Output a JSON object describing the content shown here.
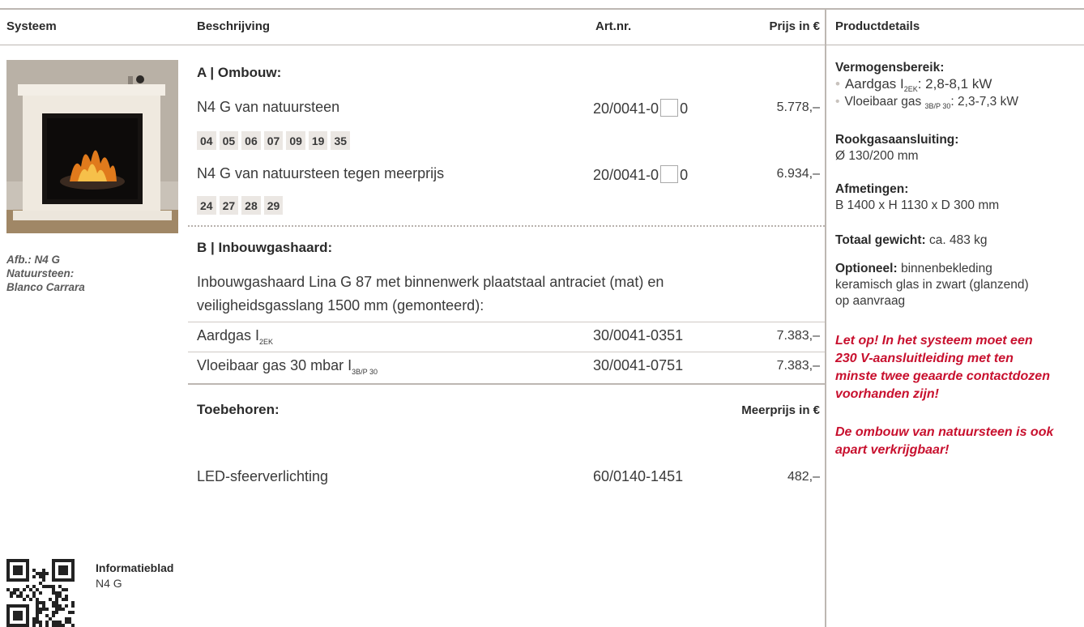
{
  "headers": {
    "systeem": "Systeem",
    "beschrijving": "Beschrijving",
    "artnr": "Art.nr.",
    "prijs": "Prijs in €",
    "productdetails": "Productdetails"
  },
  "caption": {
    "line1": "Afb.: N4 G",
    "line2": "Natuursteen:",
    "line3": "Blanco Carrara"
  },
  "section_a": {
    "title": "A | Ombouw:",
    "row1": {
      "desc": "N4 G van natuursteen",
      "art_prefix": "20/0041-0",
      "art_suffix": "0",
      "price": "5.778,–"
    },
    "codes1": [
      "04",
      "05",
      "06",
      "07",
      "09",
      "19",
      "35"
    ],
    "row2": {
      "desc": "N4 G van natuursteen tegen meerprijs",
      "art_prefix": "20/0041-0",
      "art_suffix": "0",
      "price": "6.934,–"
    },
    "codes2": [
      "24",
      "27",
      "28",
      "29"
    ]
  },
  "section_b": {
    "title": "B | Inbouwgashaard:",
    "intro1": "Inbouwgashaard Lina G 87 met binnenwerk plaatstaal antraciet (mat) en",
    "intro2": "veiligheidsgasslang 1500 mm (gemonteerd):",
    "row1": {
      "desc": "Aardgas I",
      "sub": "2EK",
      "art": "30/0041-0351",
      "price": "7.383,–"
    },
    "row2": {
      "desc": "Vloeibaar gas 30 mbar I",
      "sub": "3B/P 30",
      "art": "30/0041-0751",
      "price": "7.383,–"
    }
  },
  "accessories": {
    "title": "Toebehoren:",
    "price_header": "Meerprijs in €",
    "row1": {
      "desc": "LED-sfeerverlichting",
      "art": "60/0140-1451",
      "price": "482,–"
    }
  },
  "details": {
    "power_title": "Vermogensbereik:",
    "power1_pre": "Aardgas I",
    "power1_sub": "2EK",
    "power1_post": ": 2,8-8,1 kW",
    "power2_pre": "Vloeibaar gas",
    "power2_sub": "3B/P 30",
    "power2_post": ": 2,3-7,3 kW",
    "flue_title": "Rookgasaansluiting:",
    "flue_value": "Ø 130/200 mm",
    "dim_title": "Afmetingen:",
    "dim_value": "B 1400 x H 1130 x D 300 mm",
    "weight_label": "Totaal gewicht:",
    "weight_value": "ca. 483 kg",
    "optional_label": "Optioneel:",
    "optional_value1": "binnenbekleding",
    "optional_value2": "keramisch glas in zwart (glanzend)",
    "optional_value3": "op aanvraag",
    "note1_l1": "Let op! In het systeem moet een",
    "note1_l2": "230 V-aansluitleiding met ten",
    "note1_l3": "minste twee geaarde contactdozen",
    "note1_l4": "voorhanden zijn!",
    "note2_l1": "De ombouw van natuursteen is ook",
    "note2_l2": "apart verkrijgbaar!"
  },
  "info": {
    "title": "Informatieblad",
    "subtitle": "N4 G"
  },
  "colors": {
    "accent_red": "#c8102e",
    "rule": "#bdb7b2",
    "code_bg": "#ebe7e3"
  }
}
